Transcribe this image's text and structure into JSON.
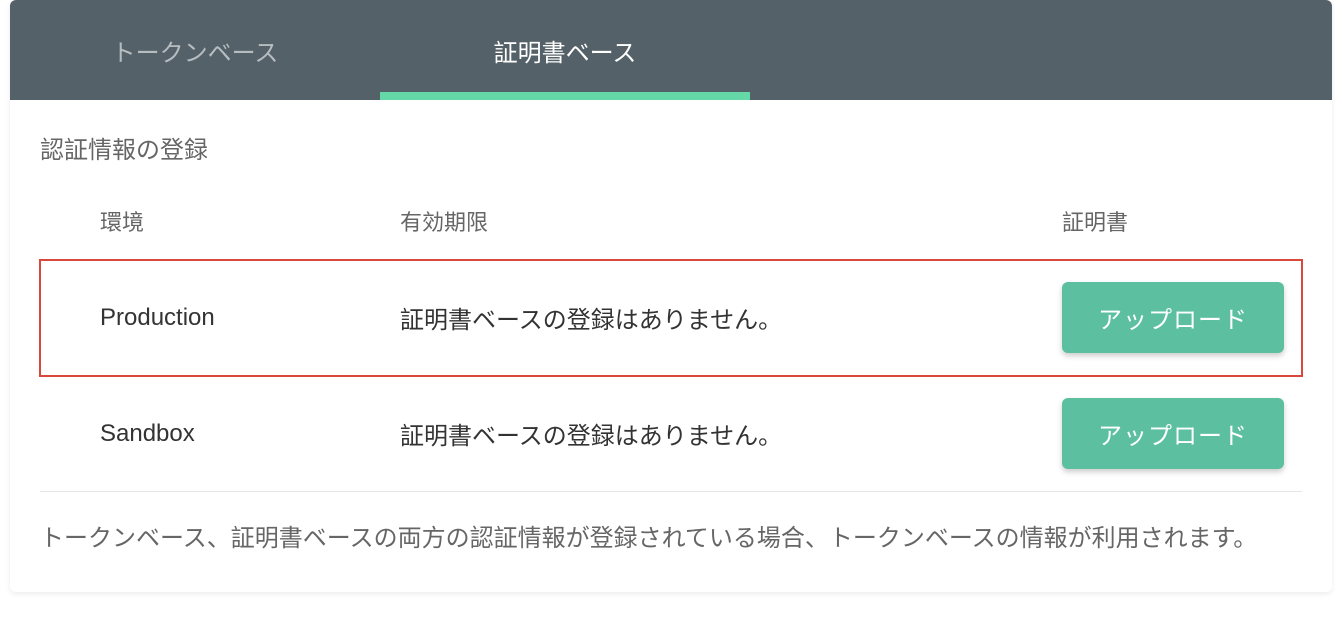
{
  "tabs": {
    "token": "トークンベース",
    "certificate": "証明書ベース"
  },
  "section_title": "認証情報の登録",
  "table": {
    "headers": {
      "environment": "環境",
      "expiry": "有効期限",
      "certificate": "証明書"
    },
    "rows": [
      {
        "environment": "Production",
        "status": "証明書ベースの登録はありません。",
        "action": "アップロード"
      },
      {
        "environment": "Sandbox",
        "status": "証明書ベースの登録はありません。",
        "action": "アップロード"
      }
    ]
  },
  "note": "トークンベース、証明書ベースの両方の認証情報が登録されている場合、トークンベースの情報が利用されます。"
}
